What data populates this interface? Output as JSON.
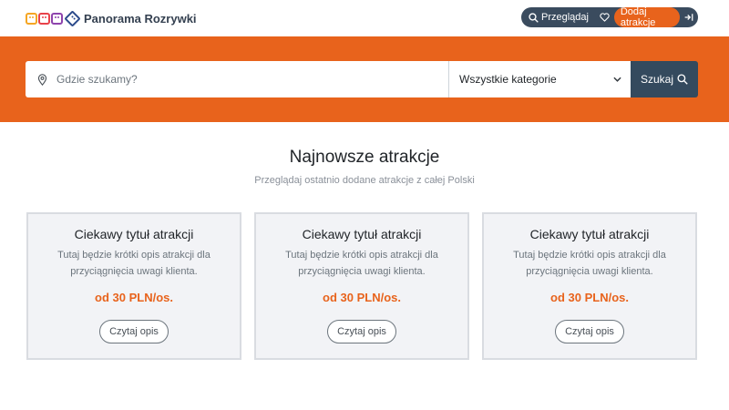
{
  "header": {
    "brand": "Panorama Rozrywki",
    "nav": {
      "browse_label": "Przeglądaj",
      "add_label": "Dodaj atrakcje"
    }
  },
  "search": {
    "location_placeholder": "Gdzie szukamy?",
    "category_selected": "Wszystkie kategorie",
    "submit_label": "Szukaj"
  },
  "section": {
    "title": "Najnowsze atrakcje",
    "subtitle": "Przeglądaj ostatnio dodane atrakcje z całej Polski"
  },
  "cards": [
    {
      "title": "Ciekawy tytuł atrakcji",
      "description": "Tutaj będzie krótki opis atrakcji dla przyciągnięcia uwagi klienta.",
      "price": "od 30 PLN/os.",
      "button": "Czytaj opis"
    },
    {
      "title": "Ciekawy tytuł atrakcji",
      "description": "Tutaj będzie krótki opis atrakcji dla przyciągnięcia uwagi klienta.",
      "price": "od 30 PLN/os.",
      "button": "Czytaj opis"
    },
    {
      "title": "Ciekawy tytuł atrakcji",
      "description": "Tutaj będzie krótki opis atrakcji dla przyciągnięcia uwagi klienta.",
      "price": "od 30 PLN/os.",
      "button": "Czytaj opis"
    }
  ],
  "icons": {
    "logo": "smiley-faces-logo-icon",
    "browse": "search-icon",
    "favorites": "heart-icon",
    "login": "sign-in-icon",
    "location": "map-pin-icon",
    "dropdown": "chevron-down-icon",
    "search_button": "search-icon"
  },
  "colors": {
    "accent": "#e8631c",
    "dark": "#344a5e",
    "card_bg": "#f2f3f6"
  }
}
